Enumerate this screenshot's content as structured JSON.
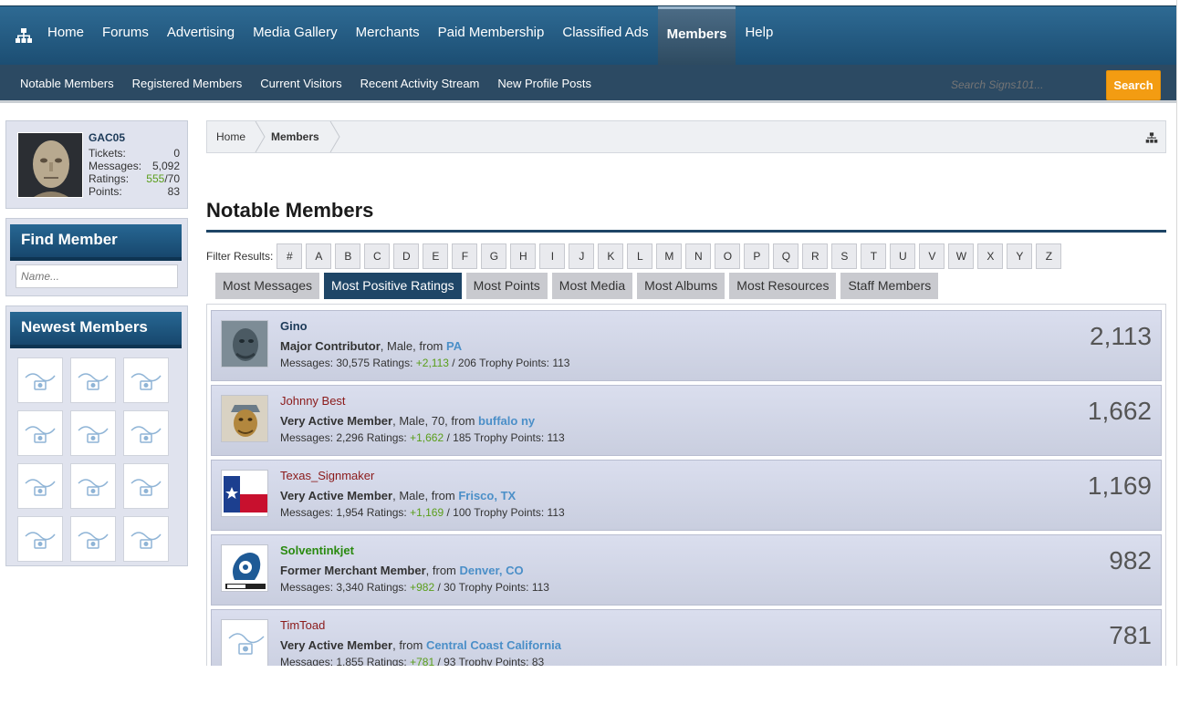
{
  "topnav": {
    "tabs": [
      {
        "label": "Home"
      },
      {
        "label": "Forums"
      },
      {
        "label": "Advertising"
      },
      {
        "label": "Media Gallery"
      },
      {
        "label": "Merchants"
      },
      {
        "label": "Paid Membership"
      },
      {
        "label": "Classified Ads"
      },
      {
        "label": "Members",
        "active": true
      },
      {
        "label": "Help"
      }
    ]
  },
  "subnav": {
    "links": [
      "Notable Members",
      "Registered Members",
      "Current Visitors",
      "Recent Activity Stream",
      "New Profile Posts"
    ],
    "search_placeholder": "Search Signs101...",
    "search_button": "Search"
  },
  "visitor": {
    "name": "GAC05",
    "tickets_label": "Tickets:",
    "tickets": "0",
    "messages_label": "Messages:",
    "messages": "5,092",
    "ratings_label": "Ratings:",
    "ratings_pos": "555",
    "ratings_total": "/70",
    "points_label": "Points:",
    "points": "83"
  },
  "find_member": {
    "title": "Find Member",
    "placeholder": "Name..."
  },
  "newest_members": {
    "title": "Newest Members"
  },
  "breadcrumb": {
    "home": "Home",
    "members": "Members"
  },
  "page_title": "Notable Members",
  "filter": {
    "label": "Filter Results:",
    "letters": [
      "#",
      "A",
      "B",
      "C",
      "D",
      "E",
      "F",
      "G",
      "H",
      "I",
      "J",
      "K",
      "L",
      "M",
      "N",
      "O",
      "P",
      "Q",
      "R",
      "S",
      "T",
      "U",
      "V",
      "W",
      "X",
      "Y",
      "Z"
    ]
  },
  "sort_tabs": [
    {
      "label": "Most Messages"
    },
    {
      "label": "Most Positive Ratings",
      "active": true
    },
    {
      "label": "Most Points"
    },
    {
      "label": "Most Media"
    },
    {
      "label": "Most Albums"
    },
    {
      "label": "Most Resources"
    },
    {
      "label": "Staff Members"
    }
  ],
  "members": [
    {
      "name": "Gino",
      "title": "Major Contributor",
      "details": ", Male, from ",
      "location": "PA",
      "messages": "30,575",
      "ratings_pos": "+2,113",
      "ratings_rest": " / 206 Trophy Points: 113",
      "score": "2,113",
      "style": "primary"
    },
    {
      "name": "Johnny Best",
      "title": "Very Active Member",
      "details": ", Male, 70, from ",
      "location": "buffalo ny",
      "messages": "2,296",
      "ratings_pos": "+1,662",
      "ratings_rest": " / 185 Trophy Points: 113",
      "score": "1,662",
      "style": "normal"
    },
    {
      "name": "Texas_Signmaker",
      "title": "Very Active Member",
      "details": ", Male, from ",
      "location": "Frisco, TX",
      "messages": "1,954",
      "ratings_pos": "+1,169",
      "ratings_rest": " / 100 Trophy Points: 113",
      "score": "1,169",
      "style": "normal"
    },
    {
      "name": "Solventinkjet",
      "title": "Former Merchant Member",
      "details": ", from ",
      "location": "Denver, CO",
      "messages": "3,340",
      "ratings_pos": "+982",
      "ratings_rest": " / 30 Trophy Points: 113",
      "score": "982",
      "style": "merchant"
    },
    {
      "name": "TimToad",
      "title": "Very Active Member",
      "details": ", from ",
      "location": "Central Coast California",
      "messages": "1,855",
      "ratings_pos": "+781",
      "ratings_rest": " / 93 Trophy Points: 83",
      "score": "781",
      "style": "normal"
    }
  ],
  "labels": {
    "messages": "Messages: ",
    "ratings": " Ratings: "
  },
  "colors": {
    "nav_blue": "#1c4e73",
    "accent_orange": "#f39c12",
    "positive_green": "#5a9e1a",
    "link_blue": "#4b8fc8"
  }
}
